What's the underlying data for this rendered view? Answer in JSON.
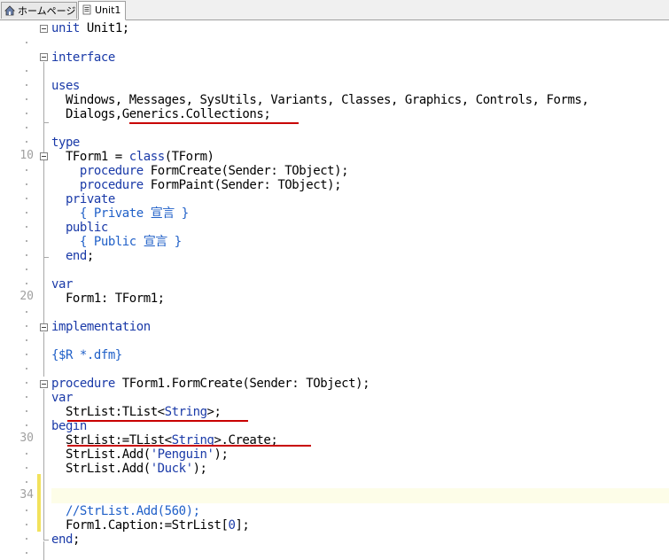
{
  "tabs": [
    {
      "label": "ホームページ",
      "icon": "home-icon"
    },
    {
      "label": "Unit1",
      "icon": "document-icon"
    }
  ],
  "line_numbers": [
    "10",
    "20",
    "30",
    "34"
  ],
  "code": {
    "l1_kw": "unit",
    "l1_rest": " Unit1;",
    "l3_kw": "interface",
    "l5_kw": "uses",
    "l6": "  Windows, Messages, SysUtils, Variants, Classes, Graphics, Controls, Forms,",
    "l7a": "  Dialogs,",
    "l7b": "Generics.Collections;",
    "l9_kw": "type",
    "l10a": "  TForm1 = ",
    "l10kw": "class",
    "l10b": "(TForm)",
    "l11kw": "    procedure",
    "l11": " FormCreate(Sender: TObject);",
    "l12kw": "    procedure",
    "l12": " FormPaint(Sender: TObject);",
    "l13kw": "  private",
    "l14": "    { Private 宣言 }",
    "l15kw": "  public",
    "l16": "    { Public 宣言 }",
    "l17kw": "  end",
    "l17": ";",
    "l19_kw": "var",
    "l20": "  Form1: TForm1;",
    "l22_kw": "implementation",
    "l24": "{$R *.dfm}",
    "l26kw": "procedure",
    "l26": " TForm1.FormCreate(Sender: TObject);",
    "l27_kw": "var",
    "l28a": "  StrList:TList<",
    "l28s": "String",
    "l28b": ">;",
    "l29_kw": "begin",
    "l30a": "  StrList:=TList<",
    "l30s": "String",
    "l30b": ">.Create;",
    "l31a": "  StrList.Add(",
    "l31s": "'Penguin'",
    "l31b": ");",
    "l32a": "  StrList.Add(",
    "l32s": "'Duck'",
    "l32b": ");",
    "l35": "  //StrList.Add(560);",
    "l36a": "  Form1.Caption:=StrList[",
    "l36n": "0",
    "l36b": "];",
    "l37kw": "end",
    "l37": ";"
  },
  "colors": {
    "keyword": "#1a3aa8",
    "comment": "#2060c8",
    "underline": "#c80000",
    "modified_marker": "#f2e25c"
  }
}
